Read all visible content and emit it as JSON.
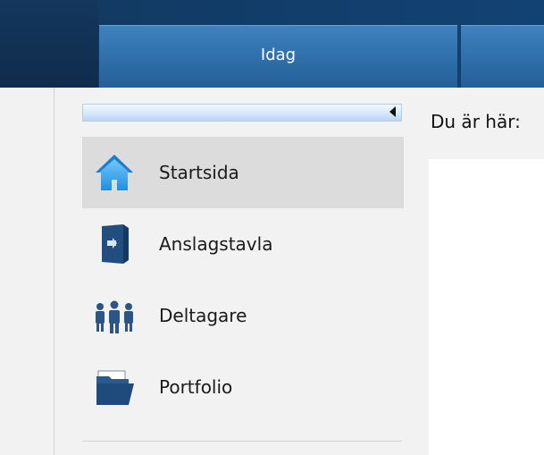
{
  "topnav": {
    "tabs": [
      {
        "label": "Idag"
      },
      {
        "label": ""
      }
    ]
  },
  "sidebar": {
    "collapse_icon": "chevron-left-icon",
    "items": [
      {
        "label": "Startsida",
        "icon": "home-icon",
        "active": true
      },
      {
        "label": "Anslagstavla",
        "icon": "door-icon",
        "active": false
      },
      {
        "label": "Deltagare",
        "icon": "people-icon",
        "active": false
      },
      {
        "label": "Portfolio",
        "icon": "folder-icon",
        "active": false
      }
    ]
  },
  "main": {
    "breadcrumb_label": "Du är här:"
  },
  "colors": {
    "nav_dark": "#123a63",
    "tab_blue": "#2f6ea9",
    "active_item": "#dcdcdc",
    "background": "#f2f2f2"
  }
}
